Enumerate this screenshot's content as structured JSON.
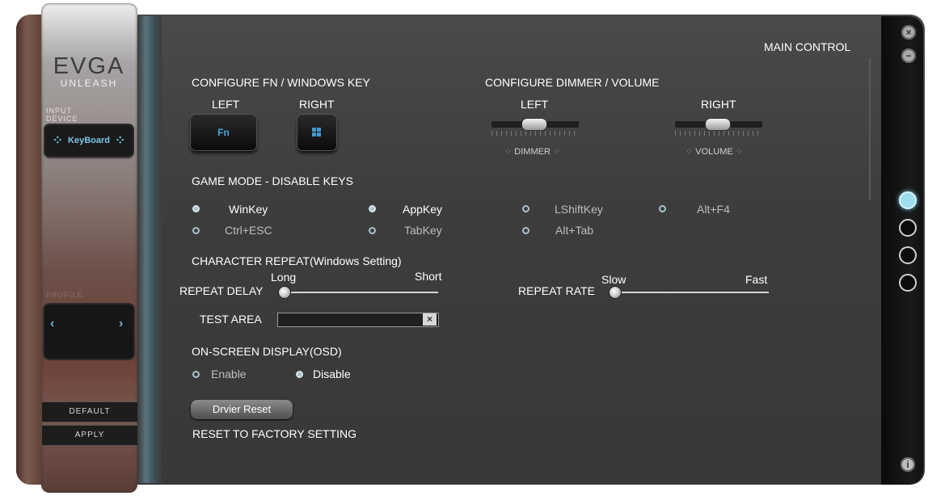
{
  "brand": {
    "logo": "EVGA",
    "tagline": "UNLEASH"
  },
  "sidebar": {
    "input_device_label": "INPUT DEVICE",
    "device_button": "KeyBoard",
    "profile_label": "PROFILE",
    "default_button": "DEFAULT",
    "apply_button": "APPLY"
  },
  "window_controls": {
    "close": "×",
    "minimize": "−",
    "info": "i"
  },
  "main": {
    "title": "MAIN CONTROL",
    "fn_section": {
      "title": "CONFIGURE FN / WINDOWS KEY",
      "left_label": "LEFT",
      "right_label": "RIGHT",
      "left_key": "Fn"
    },
    "dimmer_section": {
      "title": "CONFIGURE DIMMER / VOLUME",
      "left_label": "LEFT",
      "right_label": "RIGHT",
      "left_tag": "DIMMER",
      "right_tag": "VOLUME"
    },
    "game_mode": {
      "title": "GAME MODE - DISABLE KEYS",
      "options": [
        {
          "label": "WinKey",
          "checked": true
        },
        {
          "label": "AppKey",
          "checked": true
        },
        {
          "label": "LShiftKey",
          "checked": false
        },
        {
          "label": "Alt+F4",
          "checked": false
        },
        {
          "label": "Ctrl+ESC",
          "checked": false
        },
        {
          "label": "TabKey",
          "checked": false
        },
        {
          "label": "Alt+Tab",
          "checked": false
        }
      ]
    },
    "char_repeat": {
      "title": "CHARACTER REPEAT(Windows Setting)",
      "delay_label": "REPEAT DELAY",
      "delay_min": "Long",
      "delay_max": "Short",
      "delay_value": 0.0,
      "rate_label": "REPEAT RATE",
      "rate_min": "Slow",
      "rate_max": "Fast",
      "rate_value": 0.0
    },
    "test_area_label": "TEST AREA",
    "test_area_value": "",
    "clear_icon": "×",
    "osd": {
      "title": "ON-SCREEN DISPLAY(OSD)",
      "enable": "Enable",
      "disable": "Disable",
      "selected": "Disable"
    },
    "reset_button": "Drvier Reset",
    "reset_caption": "RESET TO FACTORY SETTING"
  },
  "colors": {
    "accent": "#7ac6e6",
    "panel": "#3f3f3f"
  }
}
